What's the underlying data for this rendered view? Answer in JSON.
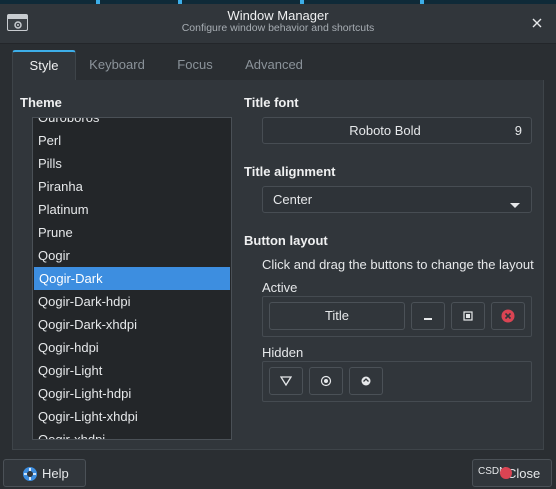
{
  "window": {
    "title": "Window Manager",
    "subtitle": "Configure window behavior and shortcuts"
  },
  "tabs": [
    {
      "label": "Style",
      "active": true
    },
    {
      "label": "Keyboard",
      "active": false
    },
    {
      "label": "Focus",
      "active": false
    },
    {
      "label": "Advanced",
      "active": false
    }
  ],
  "theme": {
    "label": "Theme",
    "items": [
      "Ouroboros",
      "Perl",
      "Pills",
      "Piranha",
      "Platinum",
      "Prune",
      "Qogir",
      "Qogir-Dark",
      "Qogir-Dark-hdpi",
      "Qogir-Dark-xhdpi",
      "Qogir-hdpi",
      "Qogir-Light",
      "Qogir-Light-hdpi",
      "Qogir-Light-xhdpi",
      "Qogir-xhdpi"
    ],
    "selected": "Qogir-Dark"
  },
  "title_font": {
    "label": "Title font",
    "name": "Roboto Bold",
    "size": "9"
  },
  "title_alignment": {
    "label": "Title alignment",
    "value": "Center"
  },
  "button_layout": {
    "label": "Button layout",
    "hint": "Click and drag the buttons to change the layout",
    "active_label": "Active",
    "title_button": "Title",
    "hidden_label": "Hidden"
  },
  "footer": {
    "help_label": "Help",
    "close_label": "Close",
    "watermark": "CSDN"
  },
  "colors": {
    "accent": "#3daee9",
    "selection": "#3d8ee0",
    "close_red": "#da4453"
  }
}
